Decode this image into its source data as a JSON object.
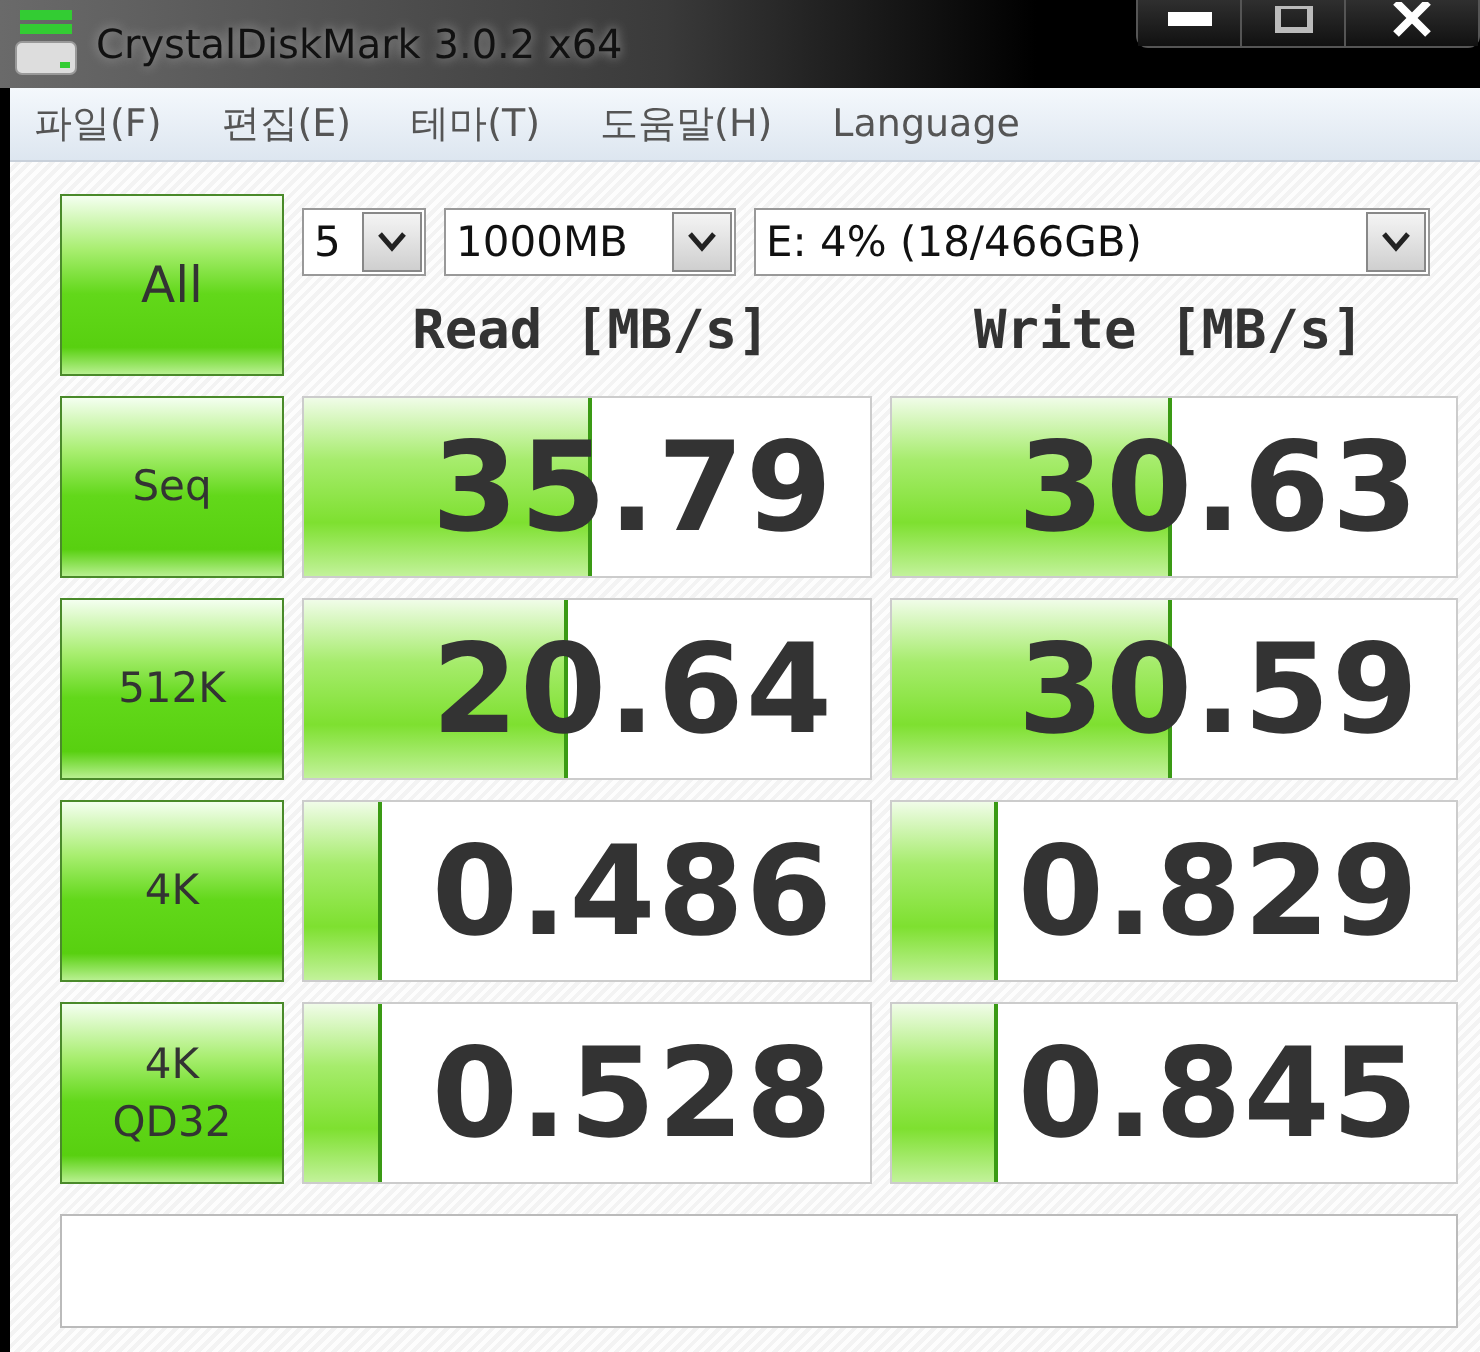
{
  "window": {
    "title": "CrystalDiskMark 3.0.2 x64"
  },
  "menu": [
    "파일(F)",
    "편집(E)",
    "테마(T)",
    "도움말(H)",
    "Language"
  ],
  "all_button": {
    "label": "All"
  },
  "dropdowns": [
    {
      "value": "5"
    },
    {
      "value": "1000MB"
    },
    {
      "value": "E: 4% (18/466GB)"
    }
  ],
  "headers": [
    "Read [MB/s]",
    "Write [MB/s]"
  ],
  "rows": [
    {
      "label": "Seq",
      "read": {
        "value": "35.79",
        "level": 0.5
      },
      "write": {
        "value": "30.63",
        "level": 0.49
      }
    },
    {
      "label": "512K",
      "read": {
        "value": "20.64",
        "level": 0.46
      },
      "write": {
        "value": "30.59",
        "level": 0.49
      }
    },
    {
      "label": "4K",
      "read": {
        "value": "0.486",
        "level": 0.13
      },
      "write": {
        "value": "0.829",
        "level": 0.18
      }
    },
    {
      "label": "4K\nQD32",
      "read": {
        "value": "0.528",
        "level": 0.13
      },
      "write": {
        "value": "0.845",
        "level": 0.18
      }
    }
  ]
}
